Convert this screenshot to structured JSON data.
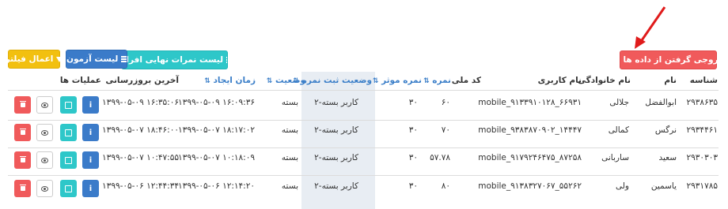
{
  "toolbar": {
    "export_label": "خروجی گرفتن از داده ها",
    "final_grades_label": "لیست نمرات نهایی افراد",
    "exam_list_label": "لیست آزمون",
    "apply_filter_label": "اعمال فیلتر"
  },
  "table": {
    "headers": {
      "id": "شناسه",
      "first_name": "نام",
      "last_name": "نام خانوادگی",
      "username": "نام کاربری",
      "national_code": "کد ملی",
      "grade": "نمره",
      "effective_grade": "نمره موثر",
      "grade_status": "وضعیت ثبت نمره",
      "status": "وضعیت",
      "created_at": "زمان ایجاد",
      "updated_at": "آخرین بروزرسانی",
      "actions": "عملیات ها"
    },
    "rows": [
      {
        "id": "۲۹۳۸۶۳۵",
        "first_name": "ابوالفضل",
        "last_name": "جلالی",
        "username": "mobile_۹۱۳۳۹۱۰۱۲۸_۶۶۹۳۱",
        "national_code": "",
        "grade": "۶۰",
        "effective_grade": "۳۰",
        "grade_status": "کاربر بسته-۲",
        "status": "بسته",
        "created_at": "۱۳۹۹-۰۵-۰۹ ۱۶:۰۹:۳۶",
        "updated_at": "۱۳۹۹-۰۵-۰۹ ۱۶:۳۵:۰۶"
      },
      {
        "id": "۲۹۳۴۴۶۱",
        "first_name": "نرگس",
        "last_name": "کمالی",
        "username": "mobile_۹۳۸۳۸۷۰۹۰۲_۱۴۴۴۷",
        "national_code": "",
        "grade": "۷۰",
        "effective_grade": "۳۰",
        "grade_status": "کاربر بسته-۲",
        "status": "بسته",
        "created_at": "۱۳۹۹-۰۵-۰۷ ۱۸:۱۷:۰۲",
        "updated_at": "۱۳۹۹-۰۵-۰۷ ۱۸:۴۶:۰۰"
      },
      {
        "id": "۲۹۳۰۳۰۳",
        "first_name": "سعید",
        "last_name": "ساربانی",
        "username": "mobile_۹۱۷۹۲۴۶۴۷۵_۸۷۲۵۸",
        "national_code": "",
        "grade": "۵۷.۷۸",
        "effective_grade": "۳۰",
        "grade_status": "کاربر بسته-۲",
        "status": "بسته",
        "created_at": "۱۳۹۹-۰۵-۰۷ ۱۰:۱۸:۰۹",
        "updated_at": "۱۳۹۹-۰۵-۰۷ ۱۰:۴۷:۵۵"
      },
      {
        "id": "۲۹۳۱۷۸۵",
        "first_name": "یاسمین",
        "last_name": "ولی",
        "username": "mobile_۹۱۳۸۳۲۷۰۶۷_۵۵۲۶۲",
        "national_code": "",
        "grade": "۸۰",
        "effective_grade": "۳۰",
        "grade_status": "کاربر بسته-۲",
        "status": "بسته",
        "created_at": "۱۳۹۹-۰۵-۰۶ ۱۲:۱۴:۲۰",
        "updated_at": "۱۳۹۹-۰۵-۰۶ ۱۲:۴۴:۳۴"
      }
    ]
  }
}
